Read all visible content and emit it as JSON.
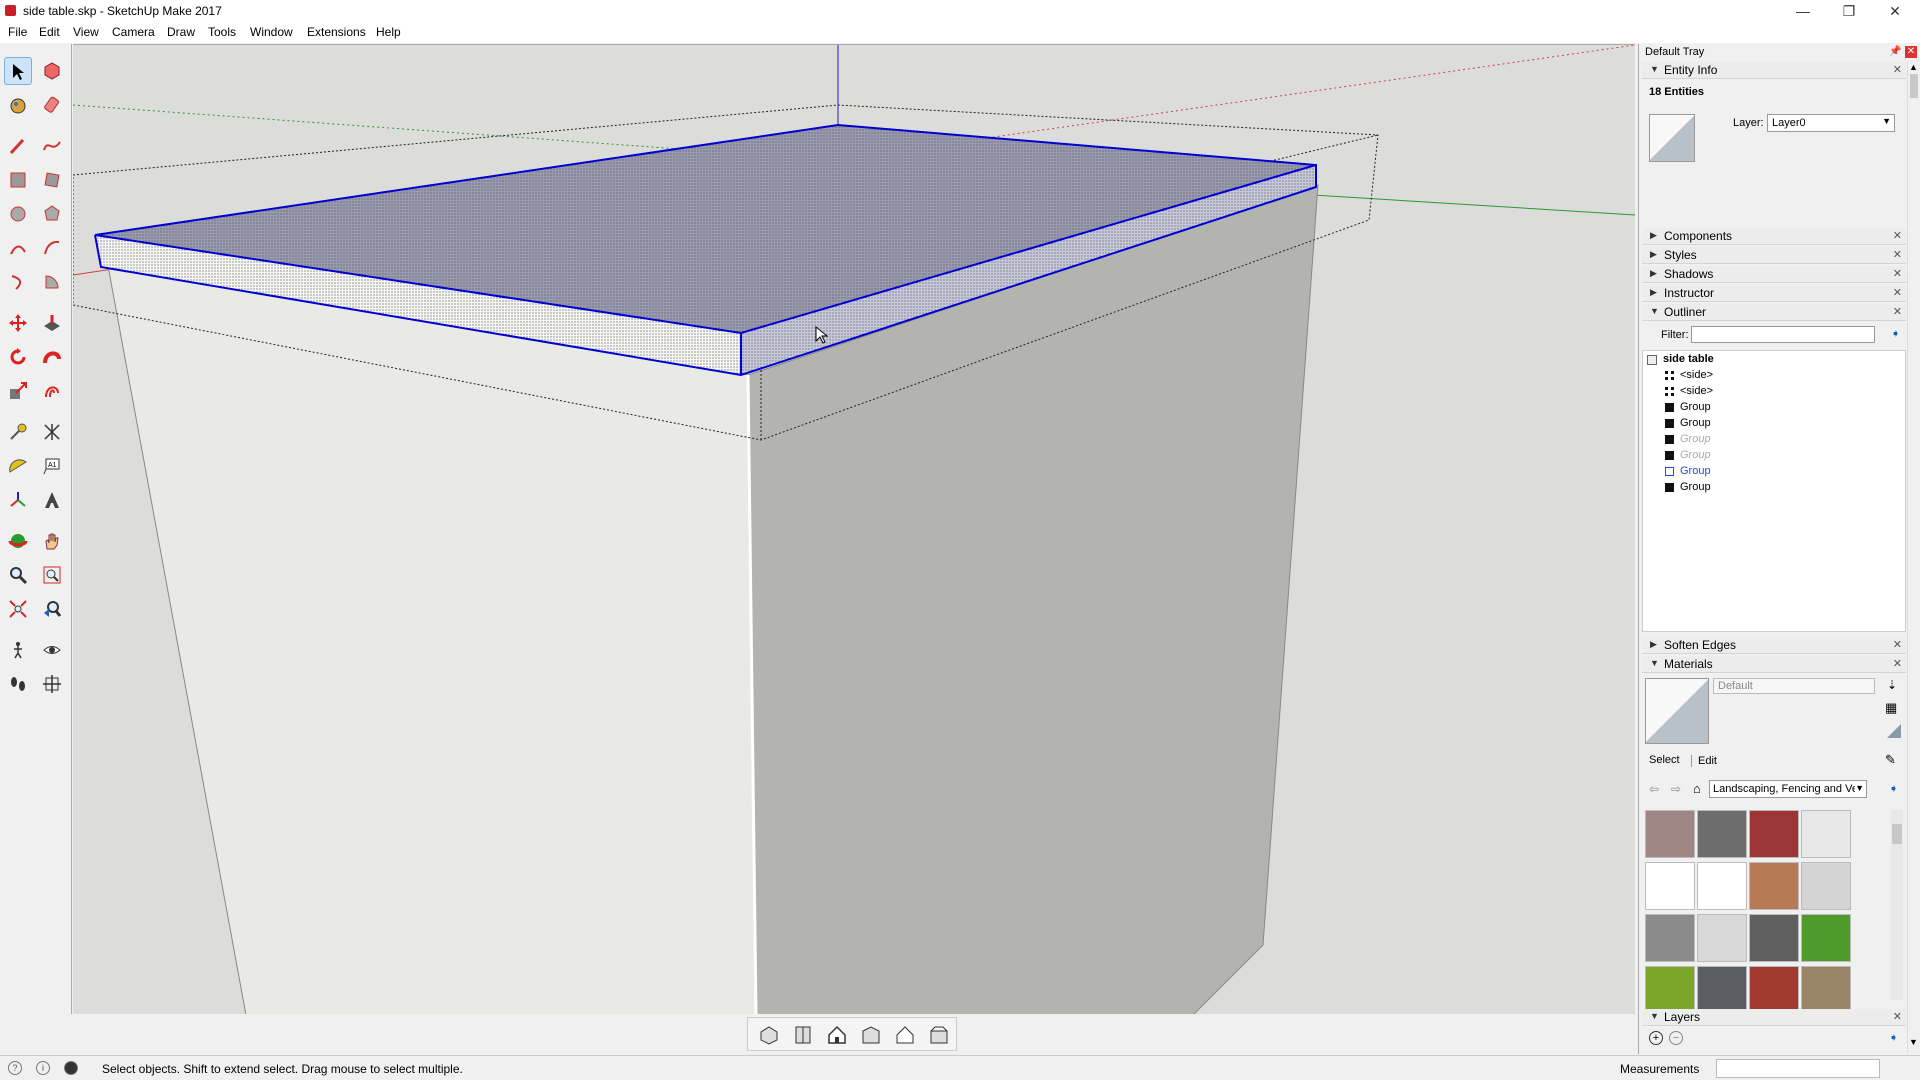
{
  "window": {
    "title": "side table.skp - SketchUp Make 2017",
    "controls": {
      "minimize": "—",
      "restore": "❐",
      "close": "✕"
    }
  },
  "menu": [
    "File",
    "Edit",
    "View",
    "Camera",
    "Draw",
    "Tools",
    "Window",
    "Extensions",
    "Help"
  ],
  "tray": {
    "title": "Default Tray",
    "entity_info": {
      "header": "Entity Info",
      "count": "18 Entities",
      "layer_label": "Layer:",
      "layer_value": "Layer0"
    },
    "collapsed_panels": [
      "Components",
      "Styles",
      "Shadows",
      "Instructor"
    ],
    "outliner": {
      "header": "Outliner",
      "filter_label": "Filter:",
      "filter_value": "",
      "root": "side table",
      "items": [
        {
          "label": "<side>",
          "style": "component"
        },
        {
          "label": "<side>",
          "style": "component"
        },
        {
          "label": "Group",
          "style": "normal"
        },
        {
          "label": "Group",
          "style": "normal"
        },
        {
          "label": "Group",
          "style": "hidden"
        },
        {
          "label": "Group",
          "style": "hidden"
        },
        {
          "label": "Group",
          "style": "selected"
        },
        {
          "label": "Group",
          "style": "normal"
        }
      ]
    },
    "soften_edges": "Soften Edges",
    "materials": {
      "header": "Materials",
      "current": "Default",
      "tabs": [
        "Select",
        "Edit"
      ],
      "collection": "Landscaping, Fencing and Ve",
      "swatch_colors": [
        "#a08784",
        "#6d6d6d",
        "#9c3535",
        "#e8e8e8",
        "#ffffff",
        "#ffffff",
        "#b67a54",
        "#d4d4d4",
        "#8b8b8b",
        "#d8d8d8",
        "#5f5f5f",
        "#4e9a2a",
        "#7aa62a",
        "#5a5e62",
        "#a03a30",
        "#9a8468"
      ]
    },
    "layers": {
      "header": "Layers"
    }
  },
  "status": {
    "message": "Select objects. Shift to extend select. Drag mouse to select multiple.",
    "measurements_label": "Measurements"
  },
  "colors": {
    "selection": "#0000d0",
    "axis_red": "#d04040",
    "axis_green": "#2a9a2a",
    "axis_blue": "#2020c0"
  }
}
